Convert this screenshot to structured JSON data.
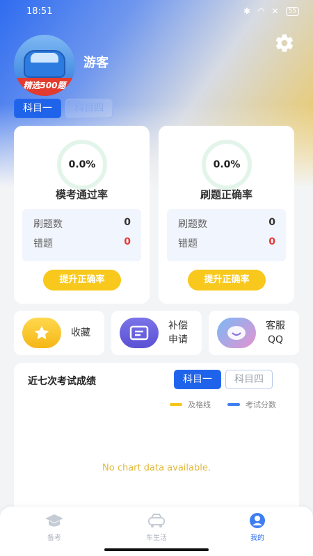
{
  "status_bar": {
    "time": "18:51",
    "battery": "55"
  },
  "profile": {
    "avatar_banner": "精选500题",
    "username": "游客"
  },
  "subject_tabs": [
    "科目一",
    "科目四"
  ],
  "stats": [
    {
      "percent": "0.0%",
      "title": "模考通过率",
      "rows": [
        {
          "label": "刷题数",
          "value": "0"
        },
        {
          "label": "错题",
          "value": "0"
        }
      ],
      "button": "提升正确率"
    },
    {
      "percent": "0.0%",
      "title": "刷题正确率",
      "rows": [
        {
          "label": "刷题数",
          "value": "0"
        },
        {
          "label": "错题",
          "value": "0"
        }
      ],
      "button": "提升正确率"
    }
  ],
  "functions": [
    {
      "label": "收藏",
      "icon": "star-icon"
    },
    {
      "label": "补偿\n申请",
      "icon": "compensation-icon"
    },
    {
      "label": "客服\nQQ",
      "icon": "customer-service-icon"
    }
  ],
  "scores": {
    "title": "近七次考试成绩",
    "tabs": [
      "科目一",
      "科目四"
    ],
    "legend": [
      {
        "label": "及格线",
        "color": "#f5c518"
      },
      {
        "label": "考试分数",
        "color": "#3f7ef0"
      }
    ],
    "empty_message": "No chart data available."
  },
  "nav": [
    {
      "label": "备考",
      "icon": "graduation-cap-icon"
    },
    {
      "label": "车生活",
      "icon": "car-icon"
    },
    {
      "label": "我的",
      "icon": "user-icon"
    }
  ],
  "colors": {
    "primary": "#1e63e9",
    "accent_yellow": "#f8c81d",
    "error_red": "#e53935"
  }
}
